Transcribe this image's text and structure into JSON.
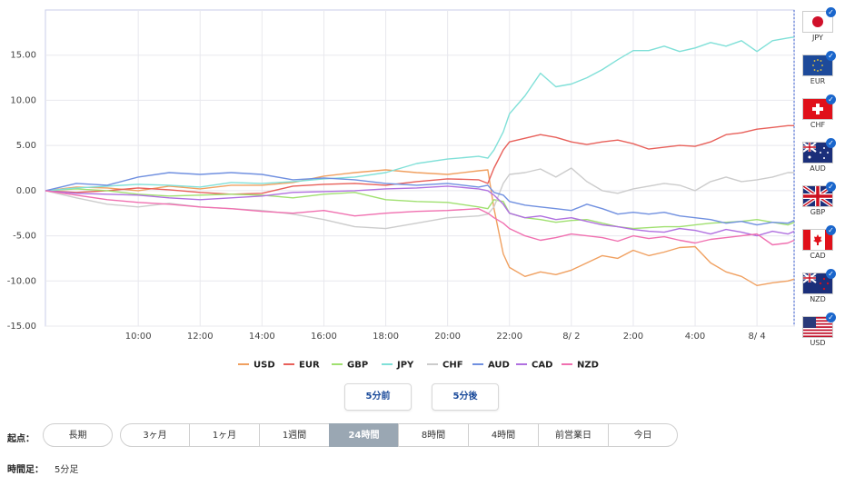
{
  "chart_data": {
    "type": "line",
    "ylim": [
      -15,
      20
    ],
    "y_ticks": [
      "15.00",
      "10.00",
      "5.00",
      "0.00",
      "-5.00",
      "-10.00",
      "-15.00"
    ],
    "y_tick_values": [
      15,
      10,
      5,
      0,
      -5,
      -10,
      -15
    ],
    "x_tick_labels": [
      "10:00",
      "12:00",
      "14:00",
      "16:00",
      "18:00",
      "20:00",
      "22:00",
      "8/ 2",
      "2:00",
      "4:00",
      "8/ 4"
    ],
    "x_tick_positions": [
      3,
      5,
      7,
      9,
      11,
      13,
      15,
      17,
      19,
      21,
      23
    ],
    "x_range": [
      0,
      24.2
    ],
    "grid": true,
    "legend_position": "bottom",
    "series": [
      {
        "name": "USD",
        "color": "#f0a060",
        "x": [
          0,
          1,
          2,
          3,
          4,
          5,
          6,
          7,
          8,
          9,
          10,
          11,
          12,
          13,
          14,
          14.3,
          14.5,
          14.8,
          15,
          15.5,
          16,
          16.5,
          17,
          17.5,
          18,
          18.5,
          19,
          19.5,
          20,
          20.5,
          21,
          21.5,
          22,
          22.5,
          23,
          23.5,
          24,
          24.2
        ],
        "y": [
          0,
          0.4,
          0.3,
          0,
          0.5,
          0.2,
          0.6,
          0.6,
          0.9,
          1.6,
          2.0,
          2.3,
          2.0,
          1.8,
          2.2,
          2.3,
          -2,
          -7,
          -8.5,
          -9.5,
          -9,
          -9.3,
          -8.8,
          -8,
          -7.2,
          -7.5,
          -6.6,
          -7.2,
          -6.8,
          -6.3,
          -6.2,
          -8,
          -9,
          -9.5,
          -10.5,
          -10.2,
          -10,
          -9.8
        ]
      },
      {
        "name": "EUR",
        "color": "#e8605a",
        "x": [
          0,
          1,
          2,
          3,
          4,
          5,
          6,
          7,
          8,
          9,
          10,
          11,
          12,
          13,
          14,
          14.3,
          14.5,
          14.8,
          15,
          15.5,
          16,
          16.5,
          17,
          17.5,
          18,
          18.5,
          19,
          19.5,
          20,
          20.5,
          21,
          21.5,
          22,
          22.5,
          23,
          23.5,
          24,
          24.2
        ],
        "y": [
          0,
          -0.2,
          0,
          0.3,
          0.1,
          -0.2,
          -0.4,
          -0.3,
          0.5,
          0.7,
          0.8,
          0.6,
          1.0,
          1.3,
          1.2,
          0.8,
          2.5,
          4.5,
          5.4,
          5.8,
          6.2,
          5.9,
          5.4,
          5.1,
          5.4,
          5.6,
          5.2,
          4.6,
          4.8,
          5.0,
          4.9,
          5.4,
          6.2,
          6.4,
          6.8,
          7.0,
          7.2,
          7.2
        ]
      },
      {
        "name": "GBP",
        "color": "#a0e070",
        "x": [
          0,
          1,
          2,
          3,
          4,
          5,
          6,
          7,
          8,
          9,
          10,
          11,
          12,
          13,
          14,
          14.3,
          14.5,
          14.8,
          15,
          15.5,
          16,
          16.5,
          17,
          17.5,
          18,
          18.5,
          19,
          19.5,
          20,
          20.5,
          21,
          21.5,
          22,
          22.5,
          23,
          23.5,
          24,
          24.2
        ],
        "y": [
          0,
          0.2,
          0,
          -0.4,
          -0.6,
          -0.5,
          -0.4,
          -0.5,
          -0.8,
          -0.4,
          -0.2,
          -1.0,
          -1.2,
          -1.3,
          -1.8,
          -2.0,
          -1.0,
          -1.2,
          -2.5,
          -3.0,
          -3.2,
          -3.5,
          -3.3,
          -3.2,
          -3.6,
          -4.0,
          -4.2,
          -4.1,
          -4.0,
          -4.0,
          -3.8,
          -3.6,
          -3.5,
          -3.4,
          -3.2,
          -3.5,
          -3.8,
          -3.5
        ]
      },
      {
        "name": "JPY",
        "color": "#80e0d8",
        "x": [
          0,
          1,
          2,
          3,
          4,
          5,
          6,
          7,
          8,
          9,
          10,
          11,
          12,
          13,
          14,
          14.3,
          14.5,
          14.8,
          15,
          15.5,
          16,
          16.5,
          17,
          17.5,
          18,
          18.5,
          19,
          19.5,
          20,
          20.5,
          21,
          21.5,
          22,
          22.5,
          23,
          23.5,
          24,
          24.2
        ],
        "y": [
          0,
          0.3,
          0.5,
          0.7,
          0.6,
          0.4,
          0.9,
          0.8,
          1.0,
          1.3,
          1.5,
          2.0,
          3.0,
          3.5,
          3.8,
          3.6,
          4.5,
          6.5,
          8.5,
          10.5,
          13.0,
          11.5,
          11.8,
          12.5,
          13.4,
          14.5,
          15.5,
          15.5,
          16.0,
          15.4,
          15.8,
          16.4,
          16.0,
          16.6,
          15.4,
          16.6,
          16.9,
          17.0
        ]
      },
      {
        "name": "CHF",
        "color": "#cccccc",
        "x": [
          0,
          1,
          2,
          3,
          4,
          5,
          6,
          7,
          8,
          9,
          10,
          11,
          12,
          13,
          14,
          14.3,
          14.5,
          14.8,
          15,
          15.5,
          16,
          16.5,
          17,
          17.5,
          18,
          18.5,
          19,
          19.5,
          20,
          20.5,
          21,
          21.5,
          22,
          22.5,
          23,
          23.5,
          24,
          24.2
        ],
        "y": [
          0,
          -0.8,
          -1.5,
          -1.8,
          -1.4,
          -1.8,
          -2.0,
          -2.2,
          -2.6,
          -3.2,
          -4.0,
          -4.2,
          -3.6,
          -3.0,
          -2.8,
          -2.6,
          -1.8,
          0.8,
          1.8,
          2.0,
          2.4,
          1.5,
          2.5,
          1.0,
          0.0,
          -0.3,
          0.2,
          0.5,
          0.8,
          0.6,
          0.0,
          1.0,
          1.5,
          1.0,
          1.2,
          1.5,
          2.0,
          2.0
        ]
      },
      {
        "name": "AUD",
        "color": "#7090e0",
        "x": [
          0,
          1,
          2,
          3,
          4,
          5,
          6,
          7,
          8,
          9,
          10,
          11,
          12,
          13,
          14,
          14.3,
          14.5,
          14.8,
          15,
          15.5,
          16,
          16.5,
          17,
          17.5,
          18,
          18.5,
          19,
          19.5,
          20,
          20.5,
          21,
          21.5,
          22,
          22.5,
          23,
          23.5,
          24,
          24.2
        ],
        "y": [
          0,
          0.8,
          0.6,
          1.5,
          2.0,
          1.8,
          2.0,
          1.8,
          1.2,
          1.4,
          1.2,
          0.8,
          0.6,
          0.8,
          0.4,
          0.6,
          -0.2,
          -0.5,
          -1.2,
          -1.6,
          -1.8,
          -2.0,
          -2.2,
          -1.5,
          -2.0,
          -2.6,
          -2.4,
          -2.6,
          -2.4,
          -2.8,
          -3.0,
          -3.2,
          -3.6,
          -3.4,
          -3.8,
          -3.5,
          -3.6,
          -3.3
        ]
      },
      {
        "name": "CAD",
        "color": "#b070e0",
        "x": [
          0,
          1,
          2,
          3,
          4,
          5,
          6,
          7,
          8,
          9,
          10,
          11,
          12,
          13,
          14,
          14.3,
          14.5,
          14.8,
          15,
          15.5,
          16,
          16.5,
          17,
          17.5,
          18,
          18.5,
          19,
          19.5,
          20,
          20.5,
          21,
          21.5,
          22,
          22.5,
          23,
          23.5,
          24,
          24.2
        ],
        "y": [
          0,
          -0.3,
          -0.4,
          -0.5,
          -0.8,
          -1.0,
          -0.8,
          -0.6,
          -0.2,
          -0.1,
          0.0,
          0.2,
          0.3,
          0.5,
          0.2,
          0.0,
          -0.5,
          -1.5,
          -2.5,
          -3.0,
          -2.8,
          -3.2,
          -3.0,
          -3.4,
          -3.8,
          -4.0,
          -4.3,
          -4.5,
          -4.6,
          -4.2,
          -4.4,
          -4.8,
          -4.3,
          -4.6,
          -5.0,
          -4.5,
          -4.8,
          -4.5
        ]
      },
      {
        "name": "NZD",
        "color": "#f070b0",
        "x": [
          0,
          1,
          2,
          3,
          4,
          5,
          6,
          7,
          8,
          9,
          10,
          11,
          12,
          13,
          14,
          14.3,
          14.5,
          14.8,
          15,
          15.5,
          16,
          16.5,
          17,
          17.5,
          18,
          18.5,
          19,
          19.5,
          20,
          20.5,
          21,
          21.5,
          22,
          22.5,
          23,
          23.5,
          24,
          24.2
        ],
        "y": [
          0,
          -0.5,
          -1.0,
          -1.3,
          -1.5,
          -1.8,
          -2.0,
          -2.3,
          -2.5,
          -2.2,
          -2.8,
          -2.5,
          -2.3,
          -2.2,
          -2.0,
          -2.5,
          -3.0,
          -3.6,
          -4.2,
          -5.0,
          -5.5,
          -5.2,
          -4.8,
          -5.0,
          -5.2,
          -5.6,
          -5.0,
          -5.3,
          -5.1,
          -5.5,
          -5.8,
          -5.4,
          -5.2,
          -5.0,
          -4.8,
          -6.0,
          -5.8,
          -5.5
        ]
      }
    ]
  },
  "flags": [
    {
      "code": "JPY",
      "icon": "japan-flag-icon",
      "checked": true
    },
    {
      "code": "EUR",
      "icon": "eu-flag-icon",
      "checked": true
    },
    {
      "code": "CHF",
      "icon": "switzerland-flag-icon",
      "checked": true
    },
    {
      "code": "AUD",
      "icon": "australia-flag-icon",
      "checked": true
    },
    {
      "code": "GBP",
      "icon": "uk-flag-icon",
      "checked": true
    },
    {
      "code": "CAD",
      "icon": "canada-flag-icon",
      "checked": true
    },
    {
      "code": "NZD",
      "icon": "new-zealand-flag-icon",
      "checked": true
    },
    {
      "code": "USD",
      "icon": "usa-flag-icon",
      "checked": true
    }
  ],
  "nav": {
    "prev_label": "5分前",
    "next_label": "5分後"
  },
  "start_point": {
    "label": "起点：",
    "long_term_label": "長期",
    "options": [
      "3ヶ月",
      "1ヶ月",
      "1週間",
      "24時間",
      "8時間",
      "4時間",
      "前営業日",
      "今日"
    ],
    "selected": "24時間"
  },
  "timeframe": {
    "label": "時間足：",
    "value": "5分足"
  }
}
